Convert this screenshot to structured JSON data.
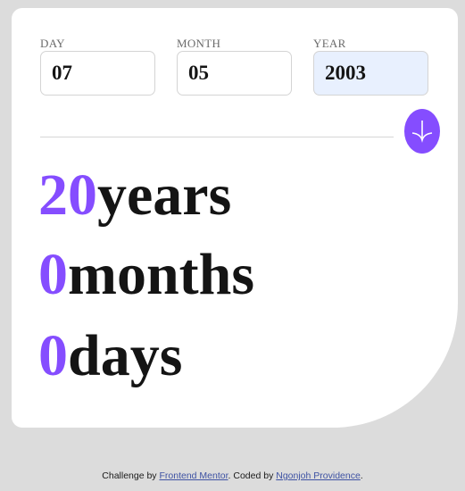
{
  "inputs": {
    "day": {
      "label": "DAY",
      "value": "07"
    },
    "month": {
      "label": "MONTH",
      "value": "05"
    },
    "year": {
      "label": "YEAR",
      "value": "2003"
    }
  },
  "submit": {
    "icon": "arrow-down-icon"
  },
  "result": {
    "years": {
      "value": "20",
      "unit": "years"
    },
    "months": {
      "value": "0",
      "unit": "months"
    },
    "days": {
      "value": "0",
      "unit": "days"
    }
  },
  "footer": {
    "prefix": "Challenge by ",
    "link1": "Frontend Mentor",
    "middle": ". Coded by ",
    "link2": "Ngonjoh Providence",
    "suffix": "."
  },
  "colors": {
    "accent": "#854dff",
    "background": "#dcdcdc",
    "card": "#ffffff",
    "active_input": "#e8f0fe"
  }
}
